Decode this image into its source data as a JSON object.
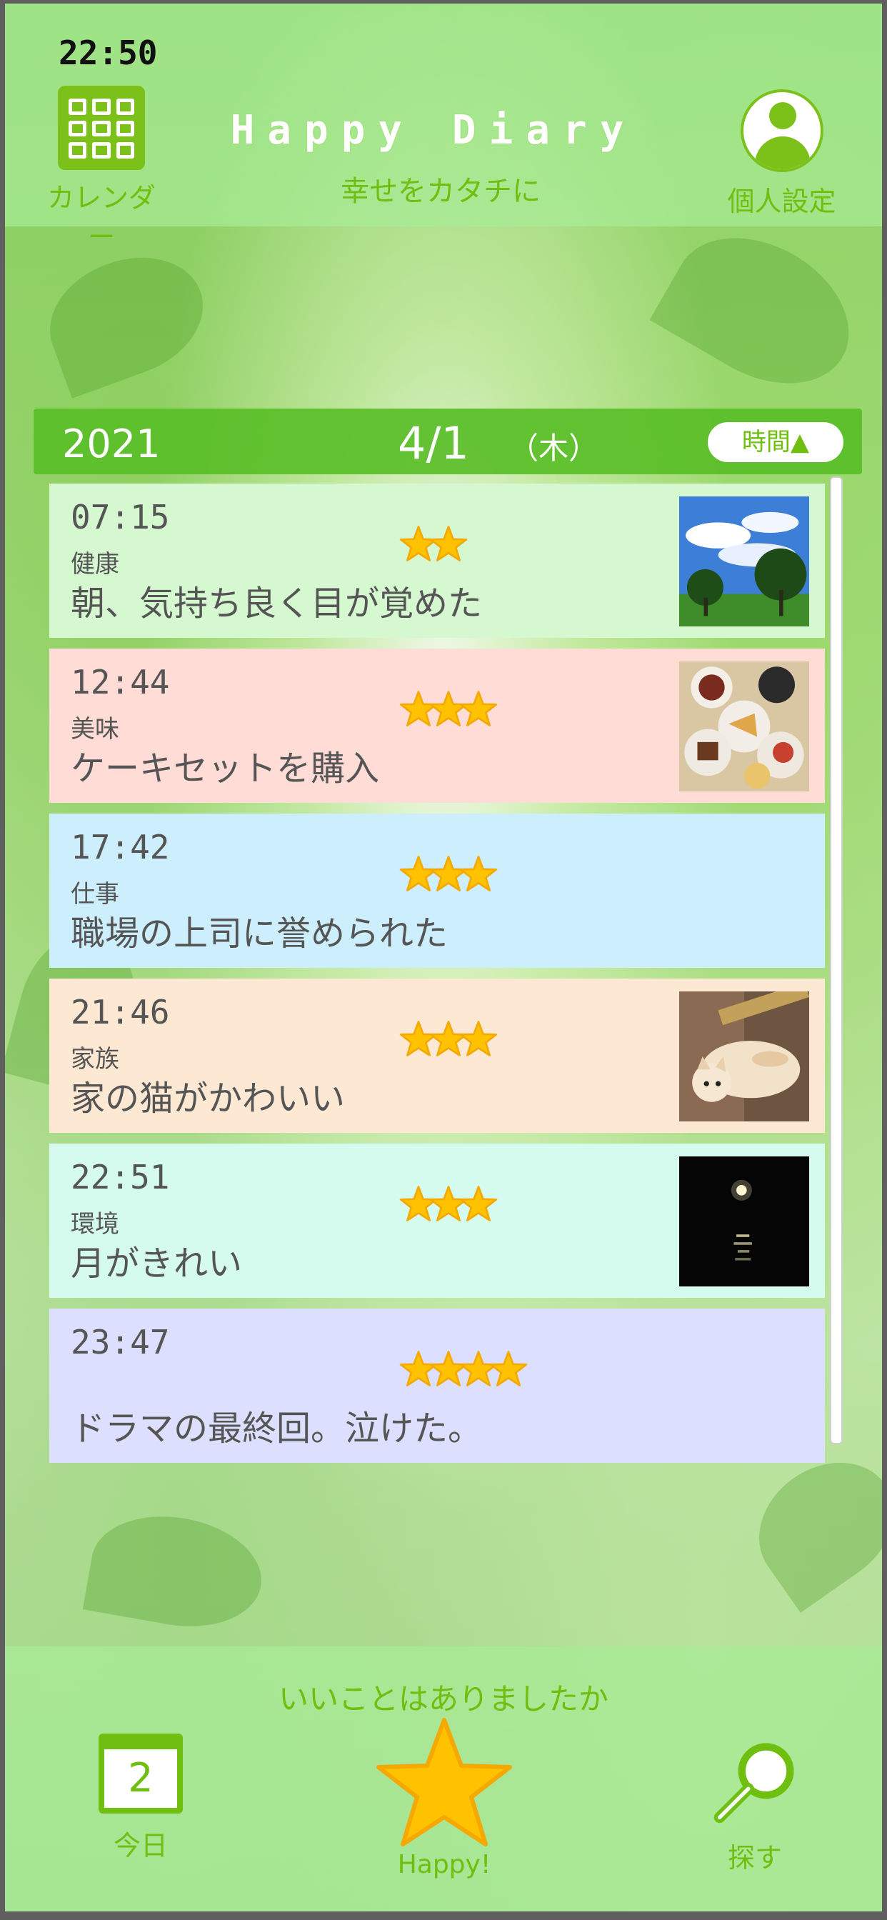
{
  "status": {
    "time": "22:50"
  },
  "header": {
    "calendar_label": "カレンダー",
    "title": "Happy Diary",
    "subtitle": "幸せをカタチに",
    "profile_label": "個人設定"
  },
  "date_bar": {
    "year": "2021",
    "month_day": "4/1",
    "weekday": "（木）",
    "sort_label": "時間▲"
  },
  "entries": [
    {
      "time": "07:15",
      "category": "健康",
      "text": "朝、気持ち良く目が覚めた",
      "stars": 2,
      "bg": "#d5f8d0",
      "photo": "sky-trees"
    },
    {
      "time": "12:44",
      "category": "美味",
      "text": "ケーキセットを購入",
      "stars": 3,
      "bg": "#ffdcd6",
      "photo": "cake-set"
    },
    {
      "time": "17:42",
      "category": "仕事",
      "text": "職場の上司に誉められた",
      "stars": 3,
      "bg": "#cdeefc",
      "photo": ""
    },
    {
      "time": "21:46",
      "category": "家族",
      "text": "家の猫がかわいい",
      "stars": 3,
      "bg": "#fde9d3",
      "photo": "cat"
    },
    {
      "time": "22:51",
      "category": "環境",
      "text": "月がきれい",
      "stars": 3,
      "bg": "#d5fbee",
      "photo": "moon"
    },
    {
      "time": "23:47",
      "category": "",
      "text": "ドラマの最終回。泣けた。",
      "stars": 4,
      "bg": "#dcdffd",
      "photo": ""
    }
  ],
  "footer": {
    "prompt": "いいことはありましたか",
    "today_day": "2",
    "today_label": "今日",
    "happy_label": "Happy!",
    "search_label": "探す"
  },
  "colors": {
    "accent": "#6fbf10",
    "star": "#ffc200",
    "star_outline": "#f5a800"
  }
}
